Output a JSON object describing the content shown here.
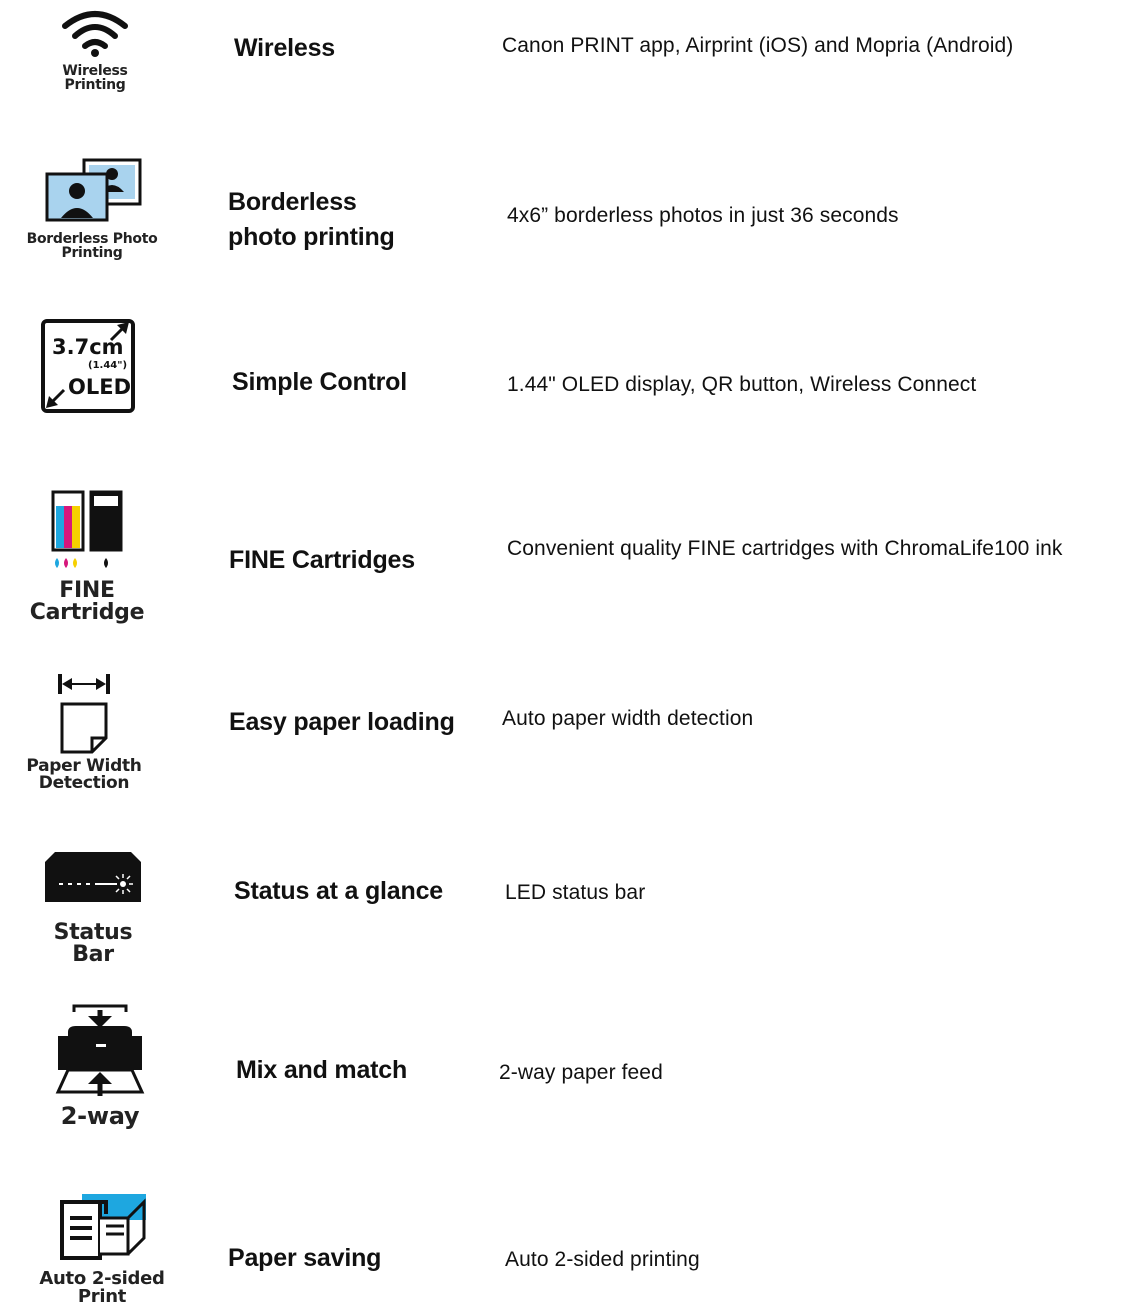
{
  "features": [
    {
      "icon": "wireless-icon",
      "caption": "Wireless Printing",
      "title": "Wireless",
      "desc": "Canon PRINT app, Airprint (iOS) and Mopria (Android)"
    },
    {
      "icon": "borderless-photo-icon",
      "caption": "Borderless Photo\nPrinting",
      "title": "Borderless\nphoto printing",
      "desc": "4x6” borderless photos in just 36 seconds"
    },
    {
      "icon": "oled-display-icon",
      "caption": "",
      "title": "Simple Control",
      "desc": "1.44\" OLED display, QR button, Wireless Connect",
      "icon_text_main": "3.7cm",
      "icon_text_sub": "(1.44\")",
      "icon_text_oled": "OLED"
    },
    {
      "icon": "fine-cartridge-icon",
      "caption": "FINE Cartridge",
      "title": "FINE Cartridges",
      "desc": "Convenient quality FINE cartridges with ChromaLife100 ink"
    },
    {
      "icon": "paper-width-icon",
      "caption": "Paper Width\nDetection",
      "title": "Easy paper loading",
      "desc": "Auto paper width detection"
    },
    {
      "icon": "status-bar-icon",
      "caption": "Status Bar",
      "title": "Status at a glance",
      "desc": "LED status bar"
    },
    {
      "icon": "two-way-feed-icon",
      "caption": "2-way",
      "title": "Mix and match",
      "desc": "2-way paper feed"
    },
    {
      "icon": "auto-duplex-icon",
      "caption": "Auto 2-sided Print",
      "title": "Paper saving",
      "desc": "Auto 2-sided printing"
    }
  ],
  "colors": {
    "cyan": "#1ea7e0",
    "magenta": "#d6177c",
    "yellow": "#f6d000",
    "black": "#111111",
    "photo_blue": "#a9d3ee"
  }
}
